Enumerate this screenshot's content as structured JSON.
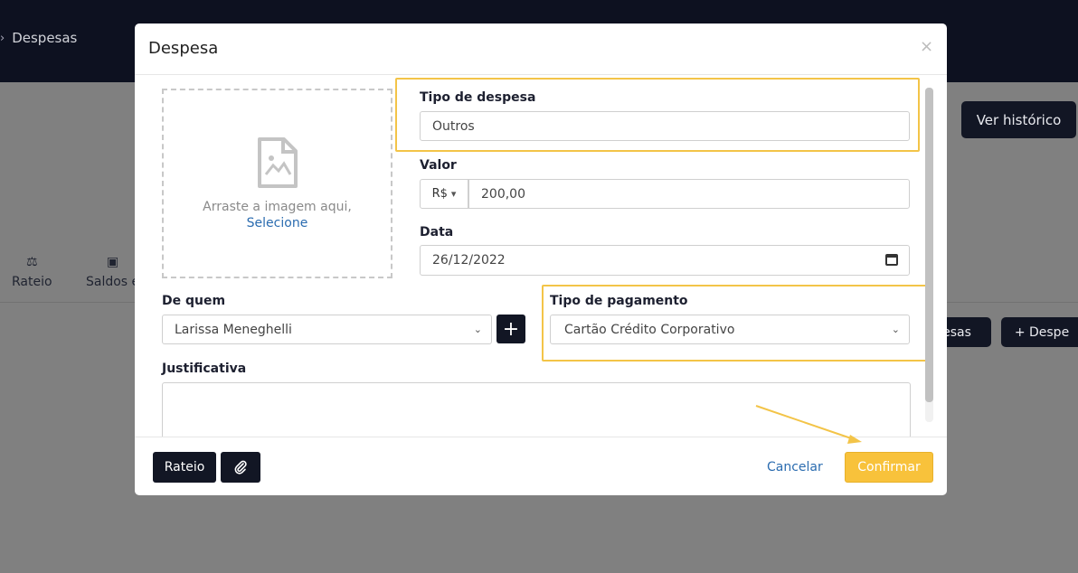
{
  "background": {
    "brand": "Despesas",
    "ver_historico": "Ver histórico",
    "tabs": [
      {
        "label": "Rateio"
      },
      {
        "label": "Saldos e"
      }
    ],
    "btn_despesas_a": "esas",
    "btn_despesas_b": "+ Despe"
  },
  "modal": {
    "title": "Despesa",
    "close": "×",
    "dropzone": {
      "text": "Arraste a imagem aqui,",
      "link": "Selecione"
    },
    "tipo_despesa": {
      "label": "Tipo de despesa",
      "value": "Outros"
    },
    "valor": {
      "label": "Valor",
      "currency": "R$",
      "value": "200,00"
    },
    "data": {
      "label": "Data",
      "value": "26/12/2022"
    },
    "de_quem": {
      "label": "De quem",
      "value": "Larissa Meneghelli"
    },
    "tipo_pagamento": {
      "label": "Tipo de pagamento",
      "value": "Cartão Crédito Corporativo"
    },
    "justificativa": {
      "label": "Justificativa",
      "value": ""
    },
    "footer": {
      "rateio": "Rateio",
      "cancelar": "Cancelar",
      "confirmar": "Confirmar"
    }
  },
  "colors": {
    "highlight": "#f3c448",
    "confirm": "#f8c23b",
    "dark": "#121624"
  }
}
